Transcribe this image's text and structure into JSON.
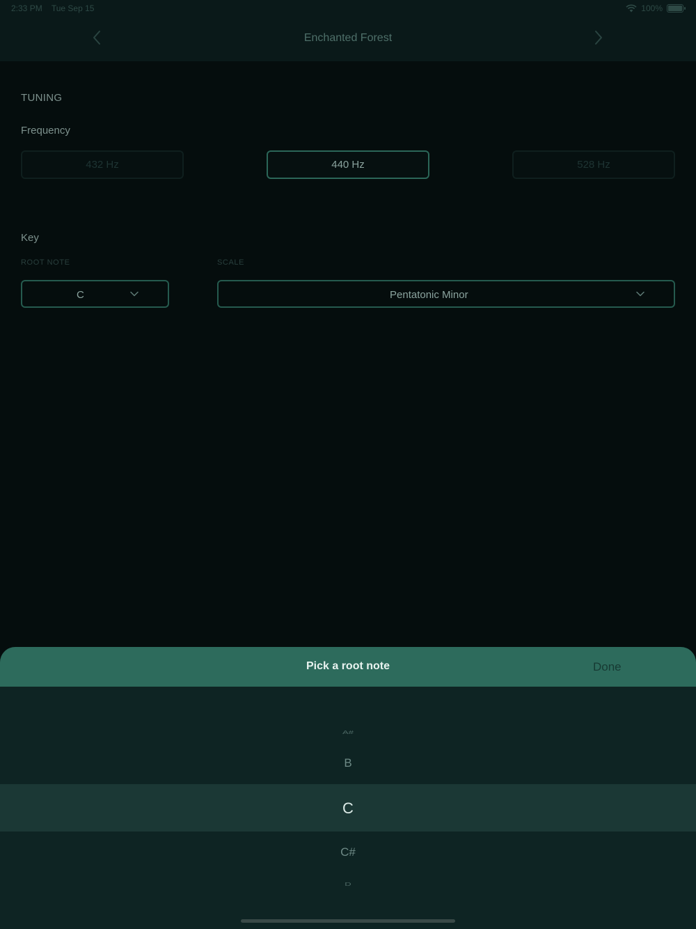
{
  "status_bar": {
    "time": "2:33 PM",
    "date": "Tue Sep 15",
    "battery": "100%"
  },
  "nav": {
    "title": "Enchanted Forest"
  },
  "tuning": {
    "section_title": "TUNING",
    "frequency_label": "Frequency",
    "frequencies": [
      {
        "label": "432 Hz",
        "selected": false
      },
      {
        "label": "440 Hz",
        "selected": true
      },
      {
        "label": "528 Hz",
        "selected": false
      }
    ]
  },
  "key": {
    "label": "Key",
    "root_note_label": "ROOT NOTE",
    "root_note_value": "C",
    "scale_label": "SCALE",
    "scale_value": "Pentatonic Minor"
  },
  "picker": {
    "title": "Pick a root note",
    "done_label": "Done",
    "items": [
      "A#",
      "B",
      "C",
      "C#",
      "D"
    ],
    "selected": "C"
  },
  "colors": {
    "accent": "#2d6b5c",
    "background": "#050d0d"
  }
}
